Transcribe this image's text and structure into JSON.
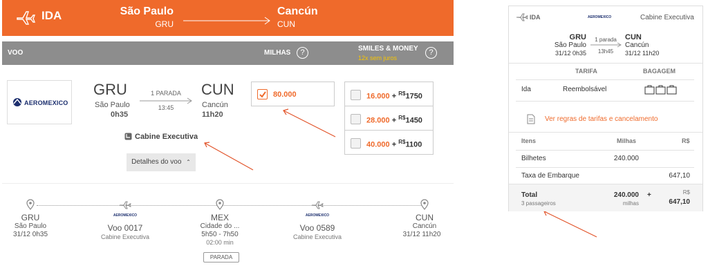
{
  "header": {
    "direction": "IDA",
    "origin_city": "São Paulo",
    "origin_code": "GRU",
    "dest_city": "Cancún",
    "dest_code": "CUN"
  },
  "columns": {
    "flight": "VOO",
    "miles": "MILHAS",
    "smiles_money": "SMILES & MONEY",
    "installments": "12x sem juros"
  },
  "flight": {
    "airline": "AEROMEXICO",
    "origin_code": "GRU",
    "origin_city": "São Paulo",
    "origin_time": "0h35",
    "stops": "1 PARADA",
    "duration": "13:45",
    "dest_code": "CUN",
    "dest_city": "Cancún",
    "dest_time": "11h20",
    "cabin": "Cabine Executiva",
    "details_button": "Detalhes do voo"
  },
  "options": {
    "miles_only": "80.000",
    "combos": [
      {
        "miles": "16.000",
        "plus": "+",
        "currency": "R$",
        "money": "1750"
      },
      {
        "miles": "28.000",
        "plus": "+",
        "currency": "R$",
        "money": "1450"
      },
      {
        "miles": "40.000",
        "plus": "+",
        "currency": "R$",
        "money": "1100"
      }
    ]
  },
  "timeline": {
    "start": {
      "code": "GRU",
      "city": "São Paulo",
      "datetime": "31/12 0h35"
    },
    "leg1": {
      "flight": "Voo 0017",
      "cabin": "Cabine Executiva"
    },
    "stop": {
      "code": "MEX",
      "city": "Cidade do ...",
      "times": "5h50 - 7h50",
      "wait": "02:00 min",
      "label": "PARADA"
    },
    "leg2": {
      "flight": "Voo 0589",
      "cabin": "Cabine Executiva"
    },
    "end": {
      "code": "CUN",
      "city": "Cancún",
      "datetime": "31/12 11h20"
    },
    "airline_mini": "AEROMEXICO"
  },
  "summary": {
    "direction": "IDA",
    "airline": "AEROMEXICO",
    "cabin": "Cabine Executiva",
    "origin_code": "GRU",
    "origin_city": "São Paulo",
    "origin_datetime": "31/12 0h35",
    "stops": "1 parada",
    "duration": "13h45",
    "dest_code": "CUN",
    "dest_city": "Cancún",
    "dest_datetime": "31/12 11h20",
    "tariff_header": "TARIFA",
    "baggage_header": "BAGAGEM",
    "leg_label": "Ida",
    "tariff_value": "Reembolsável",
    "rules_link": "Ver regras de tarifas e cancelamento",
    "items_header": "Itens",
    "miles_header": "Milhas",
    "money_header": "R$",
    "tickets_label": "Bilhetes",
    "tickets_miles": "240.000",
    "tax_label": "Taxa de Embarque",
    "tax_value": "647,10",
    "total_label": "Total",
    "passengers": "3 passageiros",
    "total_miles": "240.000",
    "total_miles_unit": "milhas",
    "total_plus": "+",
    "total_currency": "R$",
    "total_money": "647,10"
  },
  "colors": {
    "accent": "#ef6a2b",
    "bar": "#8d8d8d",
    "yellow": "#f5c400",
    "arrow": "#e2542a"
  }
}
